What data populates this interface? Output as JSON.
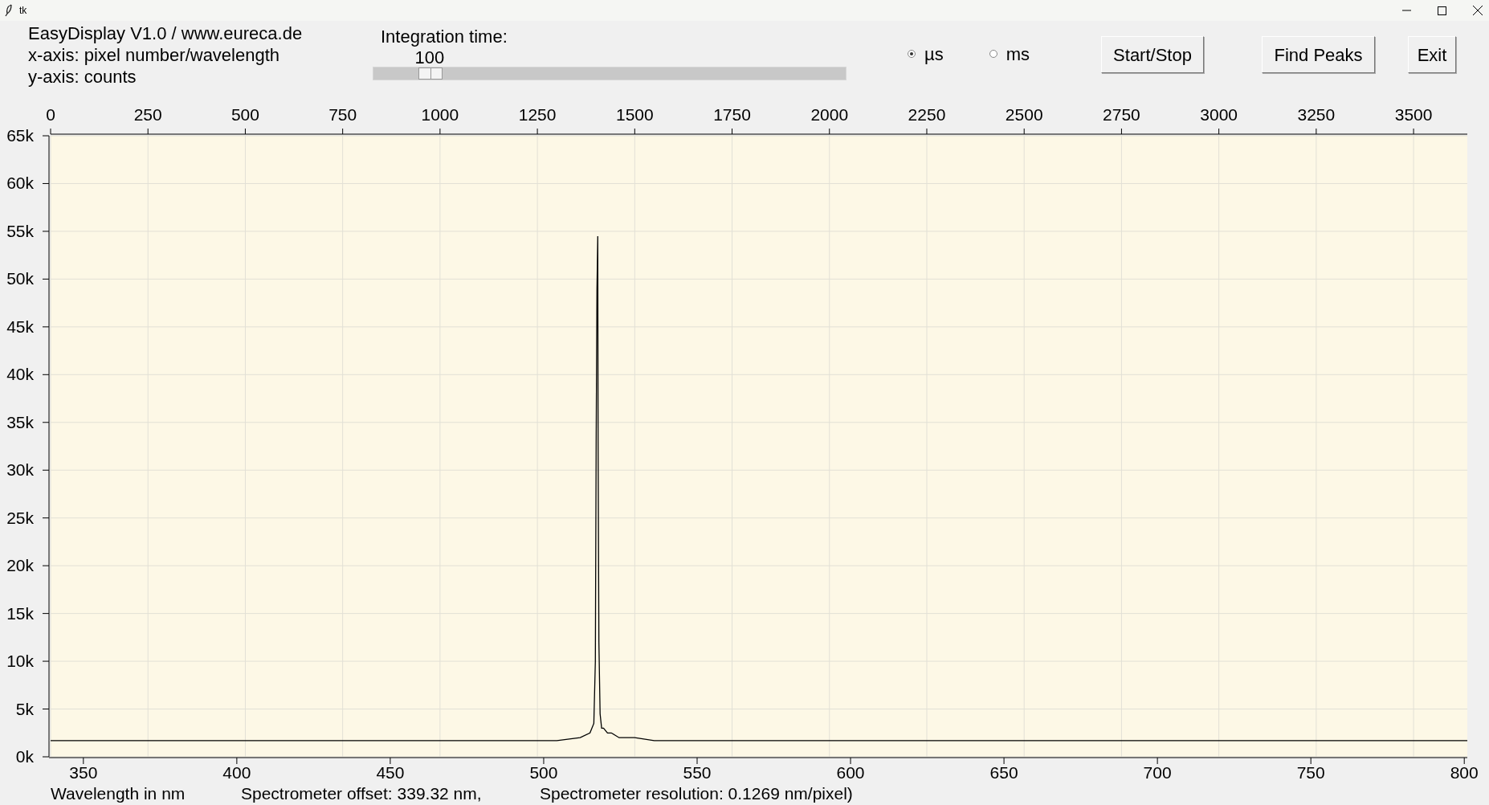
{
  "window": {
    "title": "tk"
  },
  "info_lines": [
    "EasyDisplay V1.0 / www.eureca.de",
    "x-axis: pixel number/wavelength",
    "y-axis: counts"
  ],
  "integration": {
    "label": "Integration time:",
    "value": "100",
    "level": 0.12
  },
  "units": [
    {
      "label": "µs",
      "selected": true
    },
    {
      "label": "ms",
      "selected": false
    }
  ],
  "buttons": [
    "Start/Stop",
    "Find Peaks",
    "Exit"
  ],
  "chart_data": {
    "type": "line",
    "grid": true,
    "xlim": [
      0,
      3638
    ],
    "ylim": [
      0,
      65000
    ],
    "xticks": [
      0,
      250,
      500,
      750,
      1000,
      1250,
      1500,
      1750,
      2000,
      2250,
      2500,
      2750,
      3000,
      3250,
      3500
    ],
    "yticks": [
      {
        "value": 0,
        "label": "0k"
      },
      {
        "value": 5000,
        "label": "5k"
      },
      {
        "value": 10000,
        "label": "10k"
      },
      {
        "value": 15000,
        "label": "15k"
      },
      {
        "value": 20000,
        "label": "20k"
      },
      {
        "value": 25000,
        "label": "25k"
      },
      {
        "value": 30000,
        "label": "30k"
      },
      {
        "value": 35000,
        "label": "35k"
      },
      {
        "value": 40000,
        "label": "40k"
      },
      {
        "value": 45000,
        "label": "45k"
      },
      {
        "value": 50000,
        "label": "50k"
      },
      {
        "value": 55000,
        "label": "55k"
      },
      {
        "value": 60000,
        "label": "60k"
      },
      {
        "value": 65000,
        "label": "65k"
      }
    ],
    "x": [
      0,
      200,
      400,
      600,
      800,
      1000,
      1200,
      1300,
      1360,
      1385,
      1395,
      1399,
      1401,
      1403,
      1405,
      1406,
      1408,
      1411,
      1415,
      1420,
      1430,
      1440,
      1460,
      1500,
      1550,
      1800,
      2200,
      2600,
      3000,
      3400,
      3638
    ],
    "series": [
      {
        "color": "#000000",
        "values": [
          1700,
          1700,
          1700,
          1700,
          1700,
          1700,
          1700,
          1700,
          2000,
          2500,
          3500,
          10000,
          33000,
          49000,
          54500,
          33000,
          12000,
          4500,
          3000,
          3000,
          2500,
          2500,
          2000,
          2000,
          1700,
          1700,
          1700,
          1700,
          1700,
          1700,
          1700
        ]
      }
    ]
  },
  "wavelength_axis": {
    "ticks": [
      "350",
      "400",
      "450",
      "500",
      "550",
      "600",
      "650",
      "700",
      "750",
      "800"
    ]
  },
  "footer": [
    "Wavelength in nm",
    "Spectrometer offset: 339.32 nm,",
    "Spectrometer resolution: 0.1269 nm/pixel)"
  ]
}
